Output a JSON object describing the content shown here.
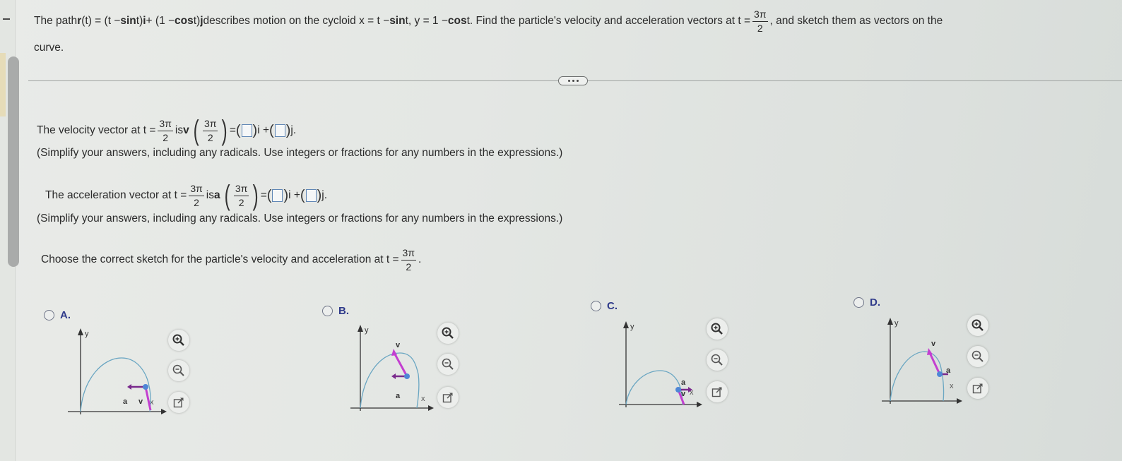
{
  "problem": {
    "intro_prefix": "The path ",
    "r_t": "r",
    "r_t_rest": "(t) = (t − ",
    "sin": "sin",
    "intro_mid1": " t)",
    "i": "i",
    "intro_mid2": " + (1 − ",
    "cos": "cos",
    "intro_mid3": " t)",
    "j": "j",
    "intro_mid4": " describes motion on the cycloid x = t − ",
    "intro_mid5": " t, y = 1 − ",
    "intro_mid6": " t. Find the particle's velocity and acceleration vectors at t = ",
    "t_num": "3π",
    "t_den": "2",
    "intro_suffix": ", and sketch them as vectors on the",
    "intro_line2": "curve."
  },
  "more_button_label": "...",
  "velocity": {
    "prefix": "The velocity vector at t = ",
    "t_num": "3π",
    "t_den": "2",
    "is": " is ",
    "symbol": "v",
    "eq": " = ",
    "i_label": "i + ",
    "j_label": "j.",
    "i_value": "",
    "j_value": "",
    "note": "(Simplify your answers, including any radicals. Use integers or fractions for any numbers in the expressions.)"
  },
  "acceleration": {
    "prefix": "The acceleration vector at t = ",
    "t_num": "3π",
    "t_den": "2",
    "is": " is ",
    "symbol": "a",
    "eq": " = ",
    "i_label": "i + ",
    "j_label": "j.",
    "i_value": "",
    "j_value": "",
    "note": "(Simplify your answers, including any radicals. Use integers or fractions for any numbers in the expressions.)"
  },
  "sketch_prompt": {
    "text": "Choose the correct sketch for the particle's velocity and acceleration at t = ",
    "t_num": "3π",
    "t_den": "2",
    "suffix": "."
  },
  "options": [
    {
      "letter": "A.",
      "selected": false,
      "axis_x": "x",
      "axis_y": "y",
      "v_label": "v",
      "a_label": "a",
      "description": "v points down along curve near x-axis; a points left"
    },
    {
      "letter": "B.",
      "selected": false,
      "axis_x": "x",
      "axis_y": "y",
      "v_label": "v",
      "a_label": "a",
      "description": "v points up-left along curve; a points left"
    },
    {
      "letter": "C.",
      "selected": false,
      "axis_x": "x",
      "axis_y": "y",
      "v_label": "v",
      "a_label": "a",
      "description": "v points down; a points right"
    },
    {
      "letter": "D.",
      "selected": false,
      "axis_x": "x",
      "axis_y": "y",
      "v_label": "v",
      "a_label": "a",
      "description": "v points up-left; a points right"
    }
  ],
  "graph_tools": {
    "zoom_in": "zoom-in",
    "zoom_out": "zoom-out",
    "open": "open-in-new-window"
  },
  "colors": {
    "curve": "#6aa6c2",
    "vector": "#c33fd0",
    "accel": "#7a2a8c",
    "point": "#4f86d6",
    "option_letter": "#2f3a8a",
    "answer_box_border": "#5f86b5"
  }
}
